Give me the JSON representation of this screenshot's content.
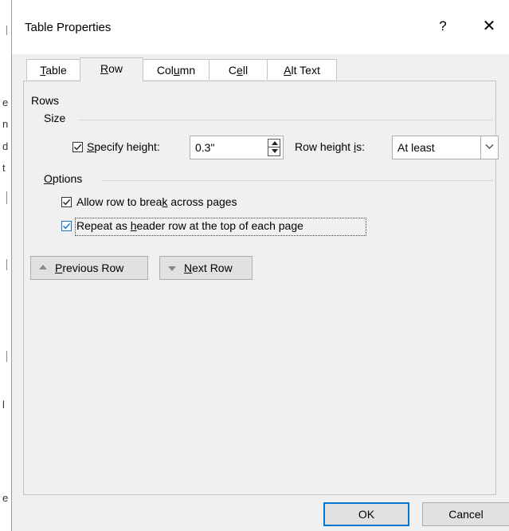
{
  "background_fragments": [
    "e",
    "n",
    "d",
    "t",
    "l",
    "e"
  ],
  "dialog": {
    "title": "Table Properties",
    "help_label": "?",
    "close_label": "✕"
  },
  "tabs": [
    {
      "label": "Table",
      "access_key": "T",
      "rest": "able",
      "selected": false
    },
    {
      "label": "Row",
      "access_key": "R",
      "rest": "ow",
      "selected": true
    },
    {
      "label": "Column",
      "pre": "Col",
      "access_key": "u",
      "rest": "mn",
      "selected": false
    },
    {
      "label": "Cell",
      "pre": "C",
      "access_key": "e",
      "rest": "ll",
      "selected": false
    },
    {
      "label": "Alt Text",
      "access_key": "A",
      "rest": "lt Text",
      "selected": false
    }
  ],
  "rows_section": {
    "heading": "Rows",
    "size_heading": "Size",
    "specify_height": {
      "access_key": "S",
      "rest": "pecify height:",
      "checked": true
    },
    "height_value": "0.3\"",
    "row_height_is": {
      "pre": "Row height ",
      "access_key": "i",
      "rest": "s:"
    },
    "row_height_mode": "At least",
    "options_heading": {
      "access_key": "O",
      "rest": "ptions"
    },
    "allow_break": {
      "pre": "Allow row to brea",
      "access_key": "k",
      "rest": " across pages",
      "checked": true
    },
    "repeat_header": {
      "pre": "Repeat as ",
      "access_key": "h",
      "rest": "eader row at the top of each page",
      "checked": true
    }
  },
  "nav": {
    "previous": {
      "access_key": "P",
      "rest": "revious Row"
    },
    "next": {
      "access_key": "N",
      "rest": "ext Row"
    }
  },
  "footer": {
    "ok_label": "OK",
    "cancel_label": "Cancel"
  },
  "colors": {
    "dialog_bg": "#f0f0f0",
    "accent": "#0078d7",
    "checkbox_focus": "#1a73d4"
  }
}
